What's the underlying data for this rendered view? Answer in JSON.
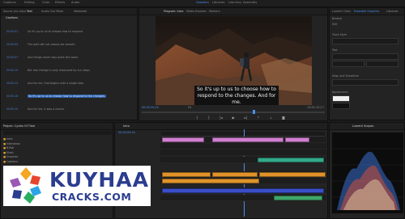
{
  "menu": {
    "items": [
      "Captions",
      "Editing",
      "Color",
      "Effects",
      "Audio",
      "Graphics",
      "Libraries",
      "Learning",
      "Assembly"
    ],
    "active_index": 5
  },
  "left_panel": {
    "tabs": [
      "Source (no clips)",
      "Text",
      "Audio Clip Mixer",
      "Metadata"
    ],
    "active_tab": 1,
    "transcript_tab": "Captions",
    "rows": [
      {
        "speaker": "00:00:01",
        "text": "So it's up to us to choose how to respond",
        "highlight": false
      },
      {
        "speaker": "00:00:04",
        "text": "The path will not always be smooth",
        "highlight": false
      },
      {
        "speaker": "00:00:07",
        "text": "And things never stay quite the same",
        "highlight": false
      },
      {
        "speaker": "00:00:10",
        "text": "But real change is only measured by our steps",
        "highlight": false
      },
      {
        "speaker": "00:00:13",
        "text": "And for me, that begins with a single step",
        "highlight": false
      },
      {
        "speaker": "00:00:16",
        "text": "So it's up to us to choose how to respond to the changes.",
        "highlight": true
      },
      {
        "speaker": "00:00:19",
        "text": "And for me, it was a choice.",
        "highlight": false
      }
    ]
  },
  "program": {
    "tabs": [
      "Program: Intro",
      "Media Browser",
      "Markers"
    ],
    "caption_line1": "So it's up to us to choose how to",
    "caption_line2": "respond to the changes. And for me.",
    "timecode_left": "00:00:20:14",
    "timecode_right": "00:01:15:17",
    "zoom": "Fit"
  },
  "effect_controls": {
    "tabs": [
      "Lumetri Color",
      "Essential Graphics",
      "Libraries"
    ],
    "labels": [
      "Browse",
      "Edit",
      "Track Style",
      "Text",
      "Align and Transform",
      "Appearance"
    ]
  },
  "project": {
    "tab": "Project: Cycles Of Time",
    "items": [
      "Intro",
      "Interviews",
      "B-Roll",
      "Music",
      "Graphics",
      "Captions"
    ]
  },
  "timeline": {
    "tab": "Intro",
    "timecode": "00:00:20:14"
  },
  "scopes": {
    "tab": "Lumetri Scopes"
  },
  "watermark": {
    "title": "KUYHAA",
    "subtitle": "CRACKS.COM"
  },
  "colors": {
    "accent": "#4a8ff0",
    "caption_clip": "#d07fd0",
    "video_clip": "#e0932a",
    "audio_clip": "#3a4fc8"
  }
}
